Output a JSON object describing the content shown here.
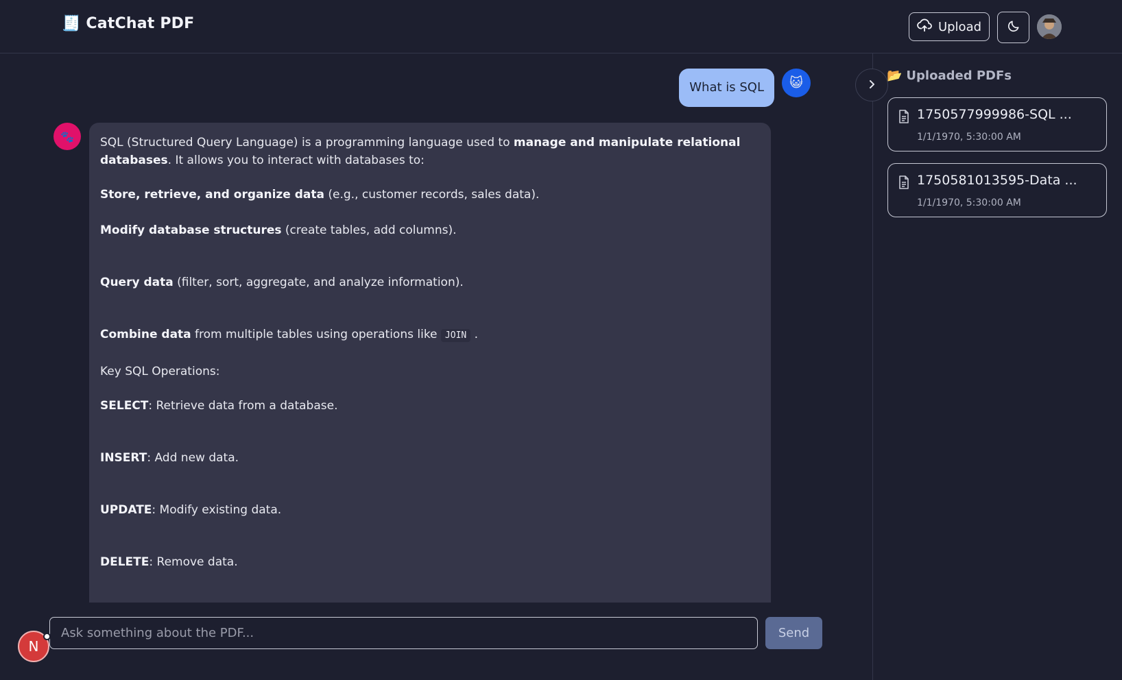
{
  "header": {
    "brand_icon": "🧾",
    "title": "CatChat PDF",
    "upload_label": "Upload"
  },
  "chat": {
    "user_message": "What is SQL",
    "user_avatar": "😺",
    "bot_avatar": "🐾",
    "bot": {
      "intro_a": "SQL (Structured Query Language) is a programming language used to ",
      "intro_bold": "manage and manipulate relational databases",
      "intro_b": ". It allows you to interact with databases to:",
      "items": [
        {
          "bold": "Store, retrieve, and organize data",
          "text": " (e.g., customer records, sales data)."
        },
        {
          "bold": "Modify database structures",
          "text": " (create tables, add columns)."
        },
        {
          "bold": "Query data",
          "text": " (filter, sort, aggregate, and analyze information)."
        }
      ],
      "combine_bold": "Combine data",
      "combine_text": " from multiple tables using operations like ",
      "combine_code": "JOIN",
      "combine_end": " .",
      "ops_heading": "Key SQL Operations:",
      "ops": [
        {
          "bold": "SELECT",
          "text": ": Retrieve data from a database."
        },
        {
          "bold": "INSERT",
          "text": ": Add new data."
        },
        {
          "bold": "UPDATE",
          "text": ": Modify existing data."
        },
        {
          "bold": "DELETE",
          "text": ": Remove data."
        }
      ]
    }
  },
  "composer": {
    "placeholder": "Ask something about the PDF...",
    "send_label": "Send",
    "badge_letter": "N"
  },
  "sidebar": {
    "title_icon": "📂",
    "title": "Uploaded PDFs",
    "files": [
      {
        "name": "1750577999986-SQL ...",
        "date": "1/1/1970, 5:30:00 AM"
      },
      {
        "name": "1750581013595-Data ...",
        "date": "1/1/1970, 5:30:00 AM"
      }
    ]
  }
}
